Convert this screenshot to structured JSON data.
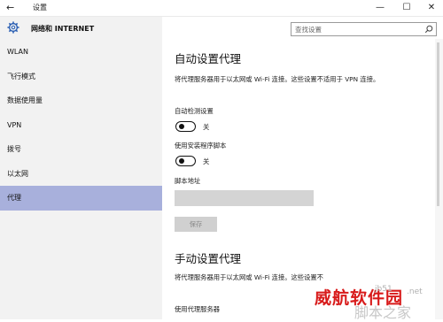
{
  "window": {
    "title": "设置",
    "back_glyph": "←",
    "minimize_glyph": "—",
    "maximize_glyph": "☐",
    "close_glyph": "✕"
  },
  "sidebar": {
    "title": "网络和 INTERNET",
    "items": [
      {
        "label": "WLAN",
        "active": false
      },
      {
        "label": "飞行模式",
        "active": false
      },
      {
        "label": "数据使用量",
        "active": false
      },
      {
        "label": "VPN",
        "active": false
      },
      {
        "label": "拨号",
        "active": false
      },
      {
        "label": "以太网",
        "active": false
      },
      {
        "label": "代理",
        "active": true
      }
    ],
    "accent_color": "#a8b0dc"
  },
  "search": {
    "placeholder": "查找设置",
    "icon": "search-icon"
  },
  "auto_proxy": {
    "heading": "自动设置代理",
    "description": "将代理服务器用于以太网或 Wi-Fi 连接。这些设置不适用于 VPN 连接。",
    "auto_detect": {
      "label": "自动检测设置",
      "state": "关",
      "on": false
    },
    "use_script": {
      "label": "使用安装程序脚本",
      "state": "关",
      "on": false
    },
    "script_address": {
      "label": "脚本地址",
      "value": ""
    },
    "save_button": "保存"
  },
  "manual_proxy": {
    "heading": "手动设置代理",
    "description": "将代理服务器用于以太网或 Wi-Fi 连接。这些设置不",
    "use_proxy_label": "使用代理服务器"
  },
  "watermark": {
    "main": "威航软件园",
    "jb": "jb51",
    "net": ".net",
    "sub": "脚本之家"
  }
}
